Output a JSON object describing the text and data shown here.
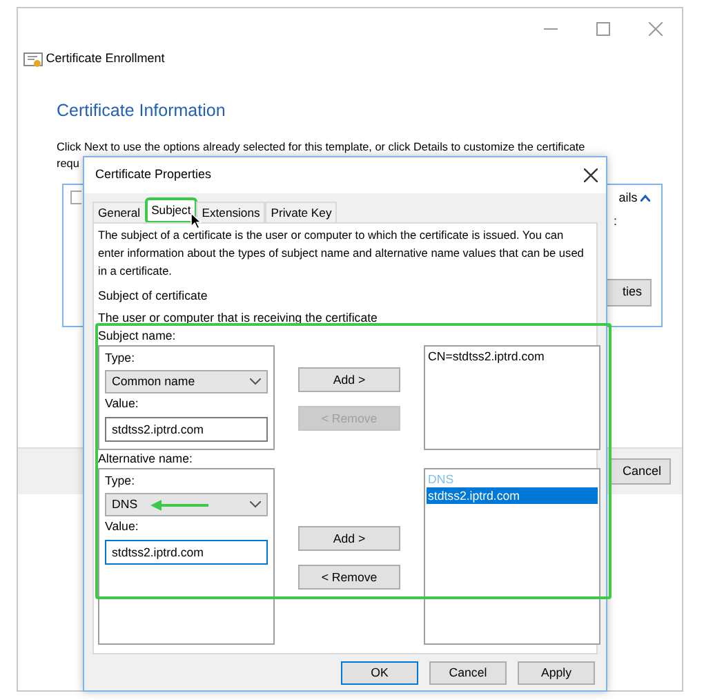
{
  "background_window": {
    "title": "Certificate Enrollment",
    "heading": "Certificate Information",
    "instruction_lines": [
      "Click Next to use the options already selected for this template, or click Details to customize the certificate",
      "requ"
    ],
    "details_link": "ails",
    "field_fragment": ":",
    "properties_button": "ties",
    "cancel_button": "Cancel"
  },
  "dialog": {
    "title": "Certificate Properties",
    "tabs": [
      {
        "label": "General",
        "selected": false
      },
      {
        "label": "Subject",
        "selected": true
      },
      {
        "label": "Extensions",
        "selected": false
      },
      {
        "label": "Private Key",
        "selected": false
      }
    ],
    "description": "The subject of a certificate is the user or computer to which the certificate is issued. You can enter information about the types of subject name and alternative name values that can be used in a certificate.",
    "section_title": "Subject of certificate",
    "section_subtitle": "The user or computer that is receiving the certificate",
    "groups": [
      {
        "label": "Subject name:",
        "fields": [
          {
            "kind": "dropdown",
            "label": "Type:",
            "value": "Common name",
            "focused": false
          },
          {
            "kind": "input",
            "label": "Value:",
            "value": "stdtss2.iptrd.com",
            "focused": false
          }
        ],
        "add_button": {
          "label": "Add >",
          "disabled": false
        },
        "remove_button": {
          "label": "< Remove",
          "disabled": true
        },
        "list": [
          {
            "text": "CN=stdtss2.iptrd.com",
            "kind": "item",
            "selected": false
          }
        ]
      },
      {
        "label": "Alternative name:",
        "fields": [
          {
            "kind": "dropdown",
            "label": "Type:",
            "value": "DNS",
            "focused": false
          },
          {
            "kind": "input",
            "label": "Value:",
            "value": "stdtss2.iptrd.com",
            "focused": true
          }
        ],
        "add_button": {
          "label": "Add >",
          "disabled": false
        },
        "remove_button": {
          "label": "< Remove",
          "disabled": false
        },
        "list": [
          {
            "text": "DNS",
            "kind": "header",
            "selected": false
          },
          {
            "text": "stdtss2.iptrd.com",
            "kind": "item",
            "selected": true
          }
        ]
      }
    ],
    "buttons": [
      {
        "label": "OK",
        "default": true
      },
      {
        "label": "Cancel",
        "default": false
      },
      {
        "label": "Apply",
        "default": false
      }
    ]
  }
}
